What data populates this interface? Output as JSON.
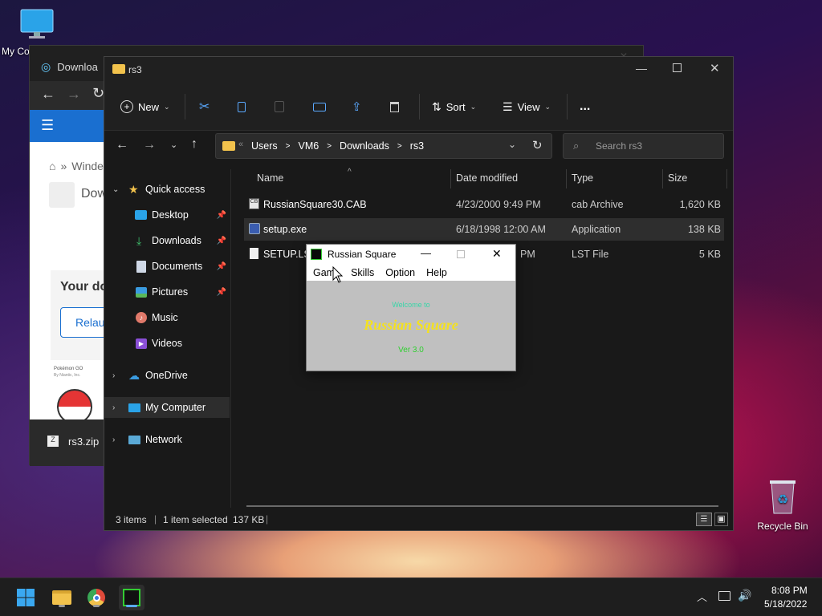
{
  "desktop": {
    "icons": [
      {
        "label": "My Computer",
        "visible_label": "My Co"
      },
      {
        "label": "Recycle Bin"
      }
    ]
  },
  "browser": {
    "tab_title": "Downloa",
    "breadcrumb_text": "Winde",
    "page_heading": "Dow",
    "card_title": "Your do",
    "button_label": "Relau",
    "app_name": "Pokémon GO",
    "app_vendor": "By Niantic, Inc.",
    "download_file": "rs3.zip"
  },
  "explorer": {
    "title": "rs3",
    "toolbar": {
      "new": "New",
      "sort": "Sort",
      "view": "View",
      "more": "..."
    },
    "address": {
      "prefix": "«",
      "path": [
        "Users",
        "VM6",
        "Downloads",
        "rs3"
      ],
      "separator": ">"
    },
    "search_placeholder": "Search rs3",
    "nav": {
      "quick_access": "Quick access",
      "items": [
        {
          "label": "Desktop",
          "pinned": true
        },
        {
          "label": "Downloads",
          "pinned": true
        },
        {
          "label": "Documents",
          "pinned": true
        },
        {
          "label": "Pictures",
          "pinned": true
        },
        {
          "label": "Music",
          "pinned": false
        },
        {
          "label": "Videos",
          "pinned": false
        }
      ],
      "onedrive": "OneDrive",
      "my_computer": "My Computer",
      "network": "Network"
    },
    "columns": [
      "Name",
      "Date modified",
      "Type",
      "Size"
    ],
    "files": [
      {
        "name": "RussianSquare30.CAB",
        "date": "4/23/2000 9:49 PM",
        "type": "cab Archive",
        "size": "1,620 KB"
      },
      {
        "name": "setup.exe",
        "date": "6/18/1998 12:00 AM",
        "type": "Application",
        "size": "138 KB"
      },
      {
        "name": "SETUP.LST",
        "date": "PM",
        "type": "LST File",
        "size": "5 KB"
      }
    ],
    "status": {
      "items": "3 items",
      "selected": "1 item selected",
      "size": "137 KB",
      "separator": "|"
    }
  },
  "russian_square": {
    "title": "Russian Square",
    "menu": [
      "Gam",
      "Skills",
      "Option",
      "Help"
    ],
    "faint_text": "Welcome to",
    "heading": "Russian Square",
    "version": "Ver 3.0"
  },
  "taskbar": {
    "time": "8:08 PM",
    "date": "5/18/2022"
  },
  "colors": {
    "accent": "#1a6fd0",
    "explorer_bg": "#191919",
    "rs_heading": "#f4e11f",
    "rs_version": "#2fd02f",
    "rs_faint": "#38d6a8"
  }
}
